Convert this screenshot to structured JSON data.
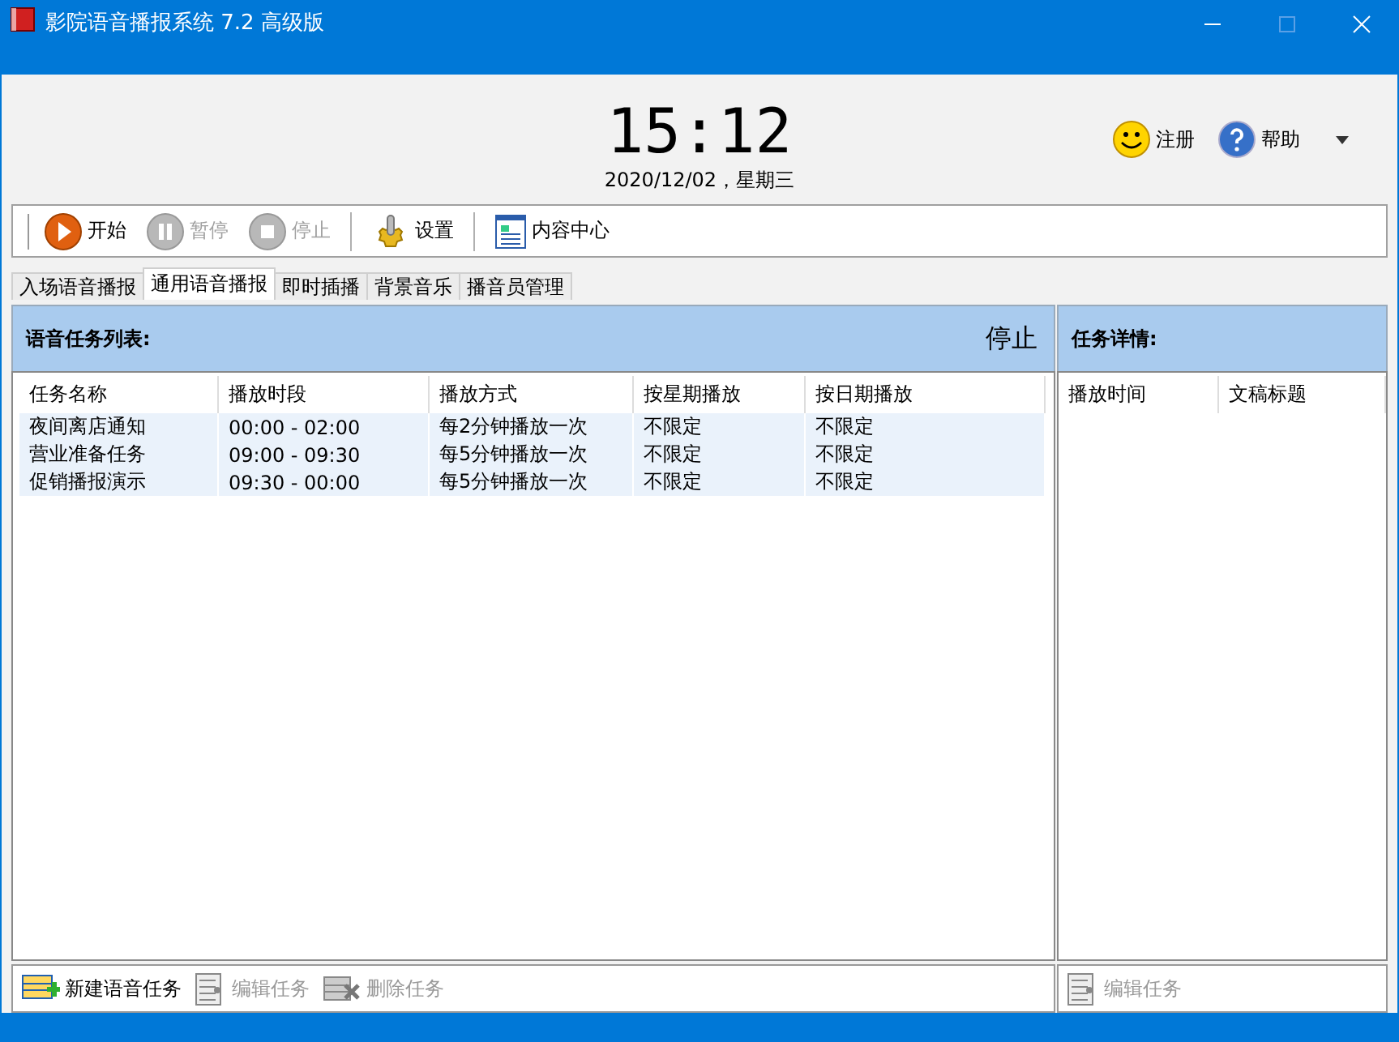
{
  "window": {
    "title": "影院语音播报系统 7.2 高级版"
  },
  "clock": {
    "time": "15:12",
    "date": "2020/12/02，星期三"
  },
  "header_links": [
    {
      "kind": "smiley",
      "label": "注册"
    },
    {
      "kind": "help",
      "label": "帮助"
    }
  ],
  "toolbar": [
    {
      "kind": "play",
      "label": "开始",
      "disabled": false
    },
    {
      "kind": "pause",
      "label": "暂停",
      "disabled": true
    },
    {
      "kind": "stop",
      "label": "停止",
      "disabled": true
    },
    {
      "kind": "gear",
      "label": "设置",
      "disabled": false
    },
    {
      "kind": "doc",
      "label": "内容中心",
      "disabled": false
    }
  ],
  "tabs": [
    {
      "label": "入场语音播报",
      "selected": false
    },
    {
      "label": "通用语音播报",
      "selected": true
    },
    {
      "label": "即时插播",
      "selected": false
    },
    {
      "label": "背景音乐",
      "selected": false
    },
    {
      "label": "播音员管理",
      "selected": false
    }
  ],
  "task_list": {
    "title": "语音任务列表:",
    "status": "停止",
    "columns": [
      "任务名称",
      "播放时段",
      "播放方式",
      "按星期播放",
      "按日期播放"
    ],
    "rows": [
      [
        "夜间离店通知",
        "00:00 - 02:00",
        "每2分钟播放一次",
        "不限定",
        "不限定"
      ],
      [
        "营业准备任务",
        "09:00 - 09:30",
        "每5分钟播放一次",
        "不限定",
        "不限定"
      ],
      [
        "促销播报演示",
        "09:30 - 00:00",
        "每5分钟播放一次",
        "不限定",
        "不限定"
      ]
    ],
    "actions": [
      {
        "kind": "add",
        "label": "新建语音任务",
        "disabled": false
      },
      {
        "kind": "edit",
        "label": "编辑任务",
        "disabled": true
      },
      {
        "kind": "delete",
        "label": "删除任务",
        "disabled": true
      }
    ]
  },
  "details": {
    "title": "任务详情:",
    "columns": [
      "播放时间",
      "文稿标题"
    ],
    "actions": [
      {
        "kind": "edit",
        "label": "编辑任务",
        "disabled": true
      }
    ]
  }
}
